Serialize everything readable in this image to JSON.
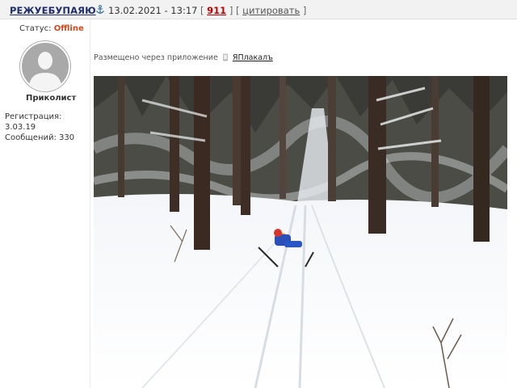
{
  "post": {
    "username": "РЕЖУЕБУПАЯЮ",
    "datetime": "13.02.2021 - 13:17",
    "bracket_open": "[",
    "number": "911",
    "bracket_mid": "] [",
    "quote_label": "цитировать",
    "bracket_close": "]"
  },
  "author": {
    "status_label": "Статус:",
    "status_value": "Offline",
    "rank": "Приколист",
    "registration": "Регистрация: 3.03.19",
    "messages": "Сообщений: 330"
  },
  "content": {
    "via_text": "Размещено через приложение",
    "app_name": "ЯПлакалъ"
  },
  "colors": {
    "username": "#1e2f6a",
    "counter": "#c00000",
    "offline": "#d0481c",
    "header_bg": "#f2f2f2"
  },
  "icons": [
    "anchor-icon",
    "phone-icon",
    "avatar-silhouette-icon"
  ]
}
